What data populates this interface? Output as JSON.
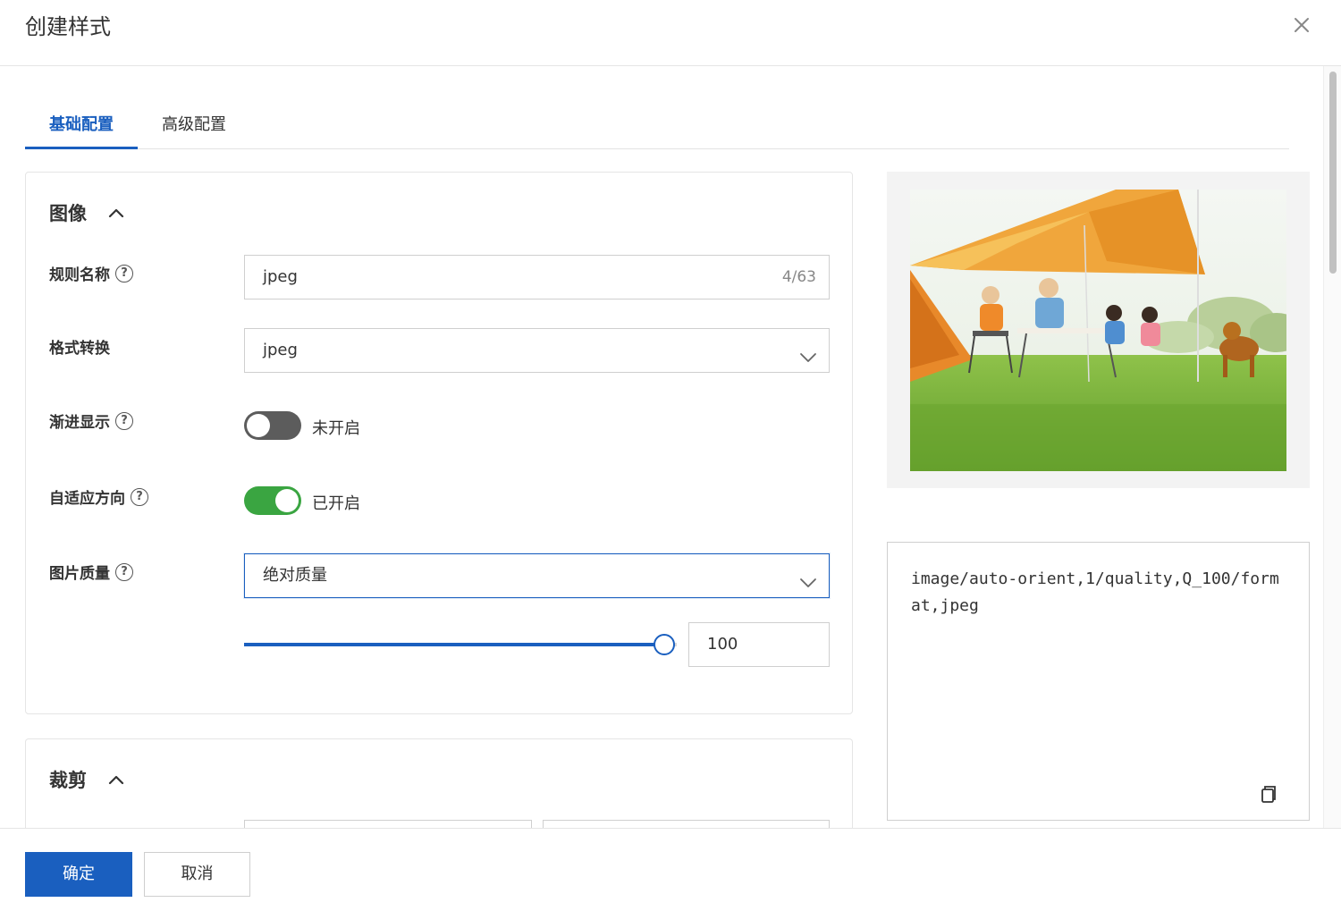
{
  "dialog": {
    "title": "创建样式"
  },
  "tabs": [
    {
      "label": "基础配置",
      "active": true
    },
    {
      "label": "高级配置",
      "active": false
    }
  ],
  "image_section": {
    "title": "图像",
    "rule_name": {
      "label": "规则名称",
      "value": "jpeg",
      "counter": "4/63"
    },
    "format": {
      "label": "格式转换",
      "value": "jpeg"
    },
    "progressive": {
      "label": "渐进显示",
      "state": "未开启",
      "enabled": false
    },
    "auto_orient": {
      "label": "自适应方向",
      "state": "已开启",
      "enabled": true
    },
    "quality": {
      "label": "图片质量",
      "mode": "绝对质量",
      "value": "100",
      "fraction": 1.0
    }
  },
  "crop_section": {
    "title": "裁剪"
  },
  "code": {
    "text": "image/auto-orient,1/quality,Q_100/format,jpeg"
  },
  "footer": {
    "ok_label": "确定",
    "cancel_label": "取消"
  },
  "colors": {
    "primary": "#1a5fbf",
    "switch_on": "#3aa541",
    "switch_off": "#5c5c5c"
  },
  "icons": {
    "close": "close-icon",
    "help": "help-circle-icon",
    "collapse": "chevron-up-icon",
    "dropdown": "chevron-down-icon",
    "copy": "copy-icon"
  }
}
